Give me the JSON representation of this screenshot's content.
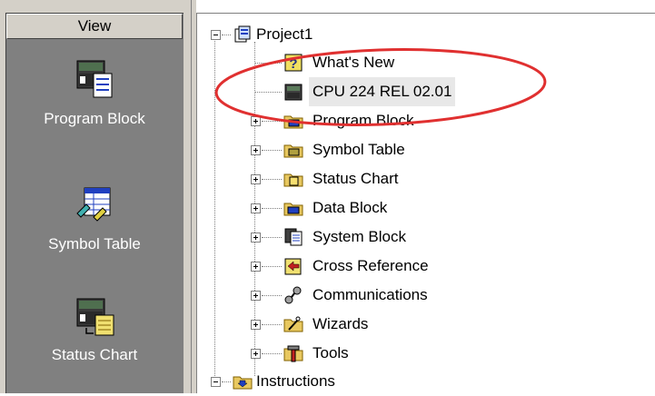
{
  "view_bar": {
    "header": "View",
    "items": [
      {
        "label": "Program Block",
        "icon": "program-block-icon"
      },
      {
        "label": "Symbol Table",
        "icon": "symbol-table-icon"
      },
      {
        "label": "Status Chart",
        "icon": "status-chart-icon"
      }
    ]
  },
  "tree": {
    "root": {
      "label": "Project1",
      "icon": "project-icon"
    },
    "children": [
      {
        "label": "What's New",
        "icon": "help-icon"
      },
      {
        "label": "CPU 224 REL 02.01",
        "icon": "cpu-icon"
      },
      {
        "label": "Program Block",
        "icon": "program-folder-icon"
      },
      {
        "label": "Symbol Table",
        "icon": "symbol-folder-icon"
      },
      {
        "label": "Status Chart",
        "icon": "status-folder-icon"
      },
      {
        "label": "Data Block",
        "icon": "data-block-icon"
      },
      {
        "label": "System Block",
        "icon": "system-block-icon"
      },
      {
        "label": "Cross Reference",
        "icon": "cross-reference-icon"
      },
      {
        "label": "Communications",
        "icon": "communications-icon"
      },
      {
        "label": "Wizards",
        "icon": "wizards-icon"
      },
      {
        "label": "Tools",
        "icon": "tools-icon"
      }
    ],
    "second_root": {
      "label": "Instructions",
      "icon": "instructions-icon"
    }
  },
  "colors": {
    "annotation_ellipse": "#e03030",
    "view_bar_bg": "#808080",
    "chrome": "#d4d0c8"
  }
}
